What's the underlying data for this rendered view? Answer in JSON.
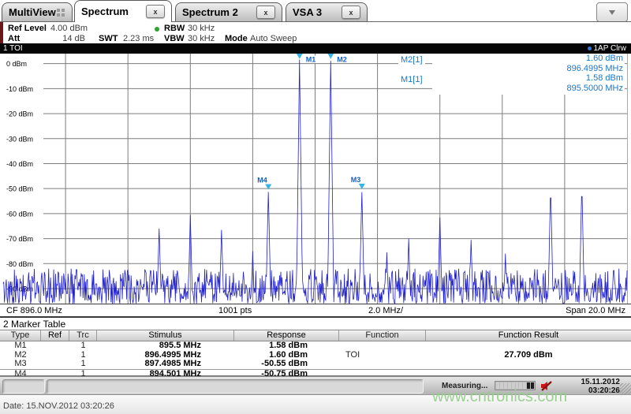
{
  "tabs": [
    {
      "label": "MultiView"
    },
    {
      "label": "Spectrum"
    },
    {
      "label": "Spectrum 2"
    },
    {
      "label": "VSA 3"
    }
  ],
  "ui": {
    "close_glyph": "x"
  },
  "settings": {
    "ref_level_label": "Ref Level",
    "ref_level": "4.00 dBm",
    "att_label": "Att",
    "att": "14 dB",
    "swt_label": "SWT",
    "swt": "2.23 ms",
    "rbw_label": "RBW",
    "rbw": "30 kHz",
    "vbw_label": "VBW",
    "vbw": "30 kHz",
    "mode_label": "Mode",
    "mode": "Auto Sweep"
  },
  "window": {
    "title": "1 TOI",
    "trace_label": "1AP Clrw"
  },
  "marker_readout": {
    "m2_name": "M2[1]",
    "m2_value": "1.60 dBm",
    "m2_freq": "896.4995 MHz",
    "m1_name": "M1[1]",
    "m1_value": "1.58 dBm",
    "m1_freq": "895.5000 MHz"
  },
  "axis": {
    "cf": "CF 896.0 MHz",
    "points": "1001 pts",
    "per_div": "2.0 MHz/",
    "span": "Span 20.0 MHz"
  },
  "marker_table": {
    "title": "2 Marker Table",
    "columns": [
      "Type",
      "Ref",
      "Trc",
      "Stimulus",
      "Response",
      "Function",
      "Function Result"
    ],
    "rows": [
      {
        "type": "M1",
        "ref": "",
        "trc": "1",
        "stimulus": "895.5 MHz",
        "response": "1.58 dBm",
        "function": "",
        "function_result": ""
      },
      {
        "type": "M2",
        "ref": "",
        "trc": "1",
        "stimulus": "896.4995 MHz",
        "response": "1.60 dBm",
        "function": "TOI",
        "function_result": "27.709 dBm"
      },
      {
        "type": "M3",
        "ref": "",
        "trc": "1",
        "stimulus": "897.4985 MHz",
        "response": "-50.55 dBm",
        "function": "",
        "function_result": ""
      },
      {
        "type": "M4",
        "ref": "",
        "trc": "1",
        "stimulus": "894.501 MHz",
        "response": "-50.75 dBm",
        "function": "",
        "function_result": ""
      }
    ]
  },
  "status": {
    "measuring": "Measuring...",
    "progress_segments": 10,
    "progress_filled": 2,
    "date": "15.11.2012",
    "time": "03:20:26"
  },
  "footer": {
    "date_line": "Date: 15.NOV.2012  03:20:26",
    "watermark": "www.cntronics.com"
  },
  "chart_data": {
    "type": "line",
    "title": "1 TOI",
    "trace_name": "1AP Clrw",
    "x": {
      "center_mhz": 896.0,
      "span_mhz": 20.0,
      "mhz_per_div": 2.0,
      "points": 1001,
      "gridline_freqs_mhz": [
        888,
        890,
        892,
        894,
        896,
        898,
        900,
        902,
        904
      ]
    },
    "y": {
      "ref_level_dbm": 4.0,
      "min_dbm": -96,
      "tick_suffix": " dBm",
      "ticks_dbm": [
        0,
        -10,
        -20,
        -30,
        -40,
        -50,
        -60,
        -70,
        -80,
        -90
      ]
    },
    "colors": {
      "trace": "#2121cd",
      "grid": "#7d7d7d",
      "marker": "#33b5e5",
      "marker_label": "#1060c8"
    },
    "noise": {
      "floor_dbm": -96,
      "top_dbm": -82,
      "shape_exp": 1.3,
      "seed": 20121115
    },
    "peaks": [
      {
        "freq_mhz": 888.35,
        "level_dbm": -79.0,
        "width_mhz": 0.05
      },
      {
        "freq_mhz": 891.0,
        "level_dbm": -66.0,
        "width_mhz": 0.07
      },
      {
        "freq_mhz": 892.0,
        "level_dbm": -60.5,
        "width_mhz": 0.07
      },
      {
        "freq_mhz": 893.0,
        "level_dbm": -66.5,
        "width_mhz": 0.07
      },
      {
        "freq_mhz": 894.0,
        "level_dbm": -75.0,
        "width_mhz": 0.05
      },
      {
        "freq_mhz": 894.501,
        "level_dbm": -50.75,
        "width_mhz": 0.08
      },
      {
        "freq_mhz": 895.5,
        "level_dbm": 1.58,
        "width_mhz": 0.1
      },
      {
        "freq_mhz": 896.4995,
        "level_dbm": 1.6,
        "width_mhz": 0.1
      },
      {
        "freq_mhz": 897.4985,
        "level_dbm": -50.55,
        "width_mhz": 0.08
      },
      {
        "freq_mhz": 898.3,
        "level_dbm": -75.5,
        "width_mhz": 0.05
      },
      {
        "freq_mhz": 899.0,
        "level_dbm": -70.0,
        "width_mhz": 0.06
      },
      {
        "freq_mhz": 900.0,
        "level_dbm": -61.5,
        "width_mhz": 0.07
      },
      {
        "freq_mhz": 901.0,
        "level_dbm": -70.5,
        "width_mhz": 0.06
      },
      {
        "freq_mhz": 902.1,
        "level_dbm": -76.0,
        "width_mhz": 0.05
      },
      {
        "freq_mhz": 903.55,
        "level_dbm": -47.7,
        "width_mhz": 0.08
      },
      {
        "freq_mhz": 904.55,
        "level_dbm": -47.0,
        "width_mhz": 0.08
      }
    ],
    "markers": [
      {
        "id": "M1",
        "freq_mhz": 895.5,
        "level_dbm": 1.58,
        "label_pos": "right"
      },
      {
        "id": "M2",
        "freq_mhz": 896.4995,
        "level_dbm": 1.6,
        "label_pos": "right"
      },
      {
        "id": "M3",
        "freq_mhz": 897.4985,
        "level_dbm": -50.55,
        "label_pos": "above"
      },
      {
        "id": "M4",
        "freq_mhz": 894.501,
        "level_dbm": -50.75,
        "label_pos": "above"
      }
    ]
  }
}
